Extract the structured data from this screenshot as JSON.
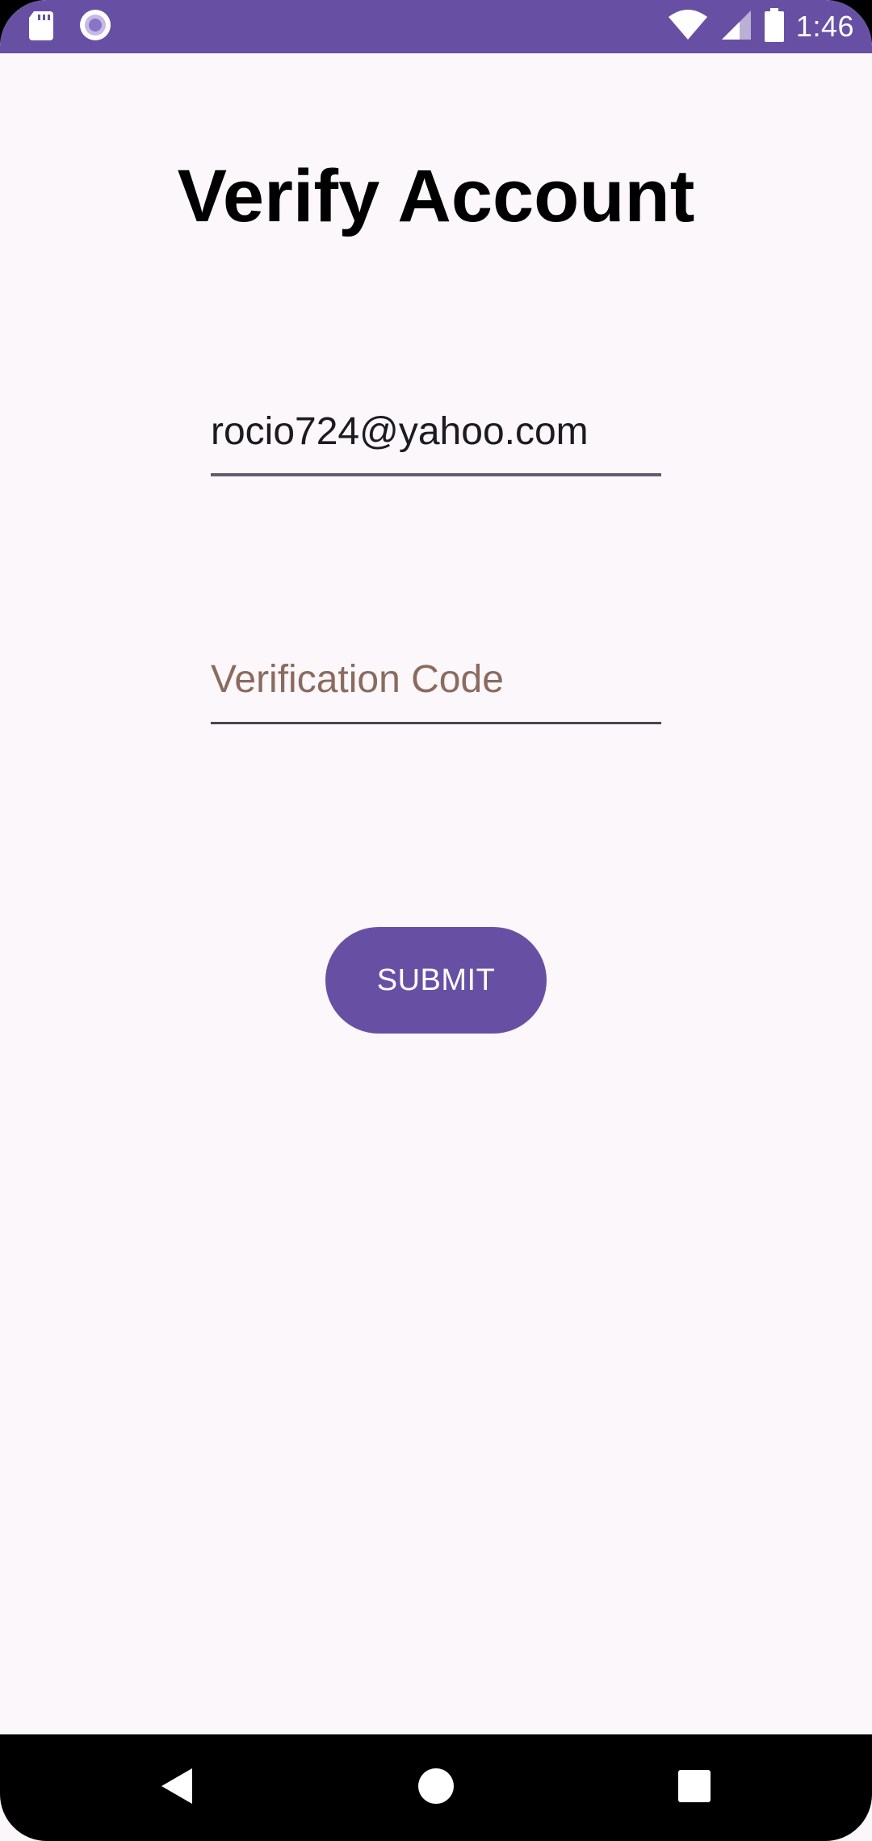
{
  "status_bar": {
    "time": "1:46",
    "left_icons": [
      "sd-card-icon",
      "record-icon"
    ],
    "right_icons": [
      "wifi-icon",
      "signal-icon",
      "battery-icon"
    ]
  },
  "screen": {
    "title": "Verify Account",
    "email_field": {
      "value": "rocio724@yahoo.com",
      "placeholder": ""
    },
    "code_field": {
      "value": "",
      "placeholder": "Verification Code"
    },
    "submit_label": "SUBMIT"
  },
  "nav_bar": {
    "icons": [
      "back-icon",
      "home-icon",
      "recents-icon"
    ]
  },
  "colors": {
    "accent": "#6750A4",
    "background": "#FCF7FB",
    "placeholder": "#8A6B5E"
  }
}
